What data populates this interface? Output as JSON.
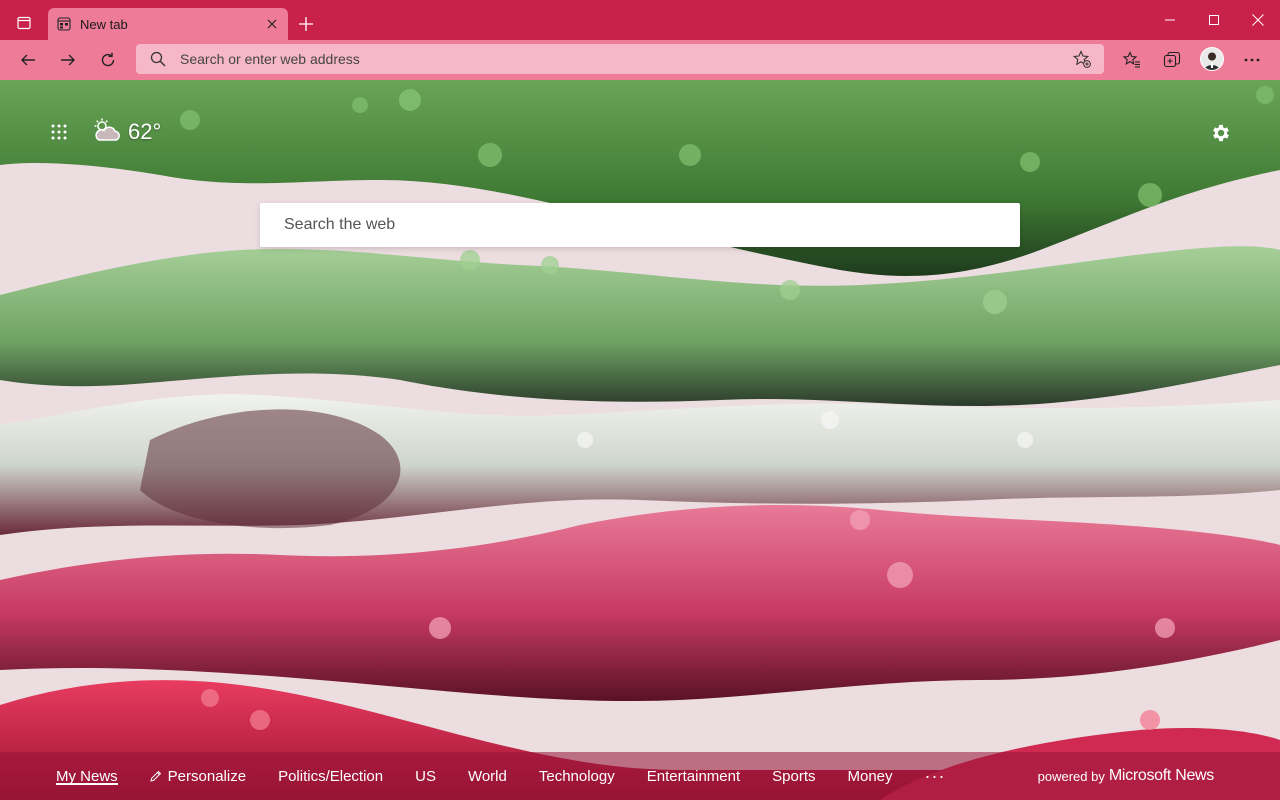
{
  "colors": {
    "titlebar": "#c8224a",
    "toolbar": "#ee7b98",
    "omnibox": "#f6b8c8"
  },
  "browser": {
    "tab": {
      "title": "New tab",
      "favicon": "new-tab-page-icon"
    },
    "address_bar": {
      "placeholder": "Search or enter web address",
      "value": ""
    }
  },
  "ntp": {
    "weather": {
      "icon": "partly-cloudy-icon",
      "temperature": "62°"
    },
    "search": {
      "placeholder": "Search the web"
    },
    "news_nav": [
      {
        "label": "My News",
        "active": true
      },
      {
        "label": "Personalize",
        "icon": "pencil-icon"
      },
      {
        "label": "Politics/Election"
      },
      {
        "label": "US"
      },
      {
        "label": "World"
      },
      {
        "label": "Technology"
      },
      {
        "label": "Entertainment"
      },
      {
        "label": "Sports"
      },
      {
        "label": "Money"
      }
    ],
    "more_label": "···",
    "powered_by": "powered by",
    "powered_brand": "Microsoft News"
  }
}
